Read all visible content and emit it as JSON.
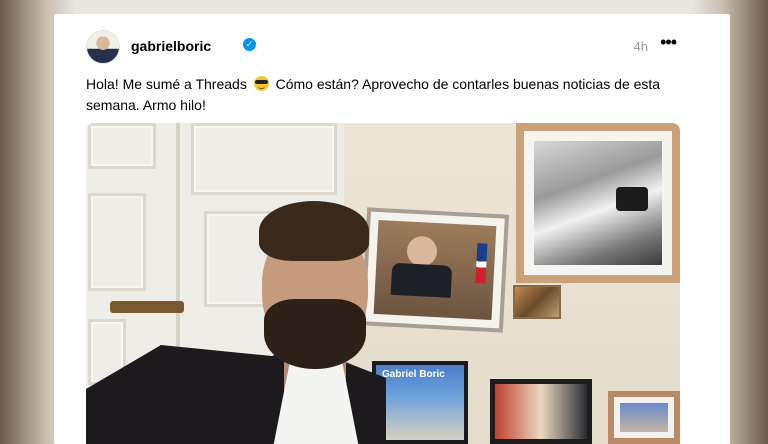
{
  "post": {
    "username": "gabrielboric",
    "verified_icon": "verified-badge-icon",
    "timestamp": "4h",
    "more_label": "•••",
    "text_before_emoji": "Hola! Me sumé a Threads",
    "emoji": "sunglasses-emoji",
    "text_after_emoji": "Cómo están? Aprovecho de contarles buenas noticias de esta semana. Armo hilo!",
    "photo_poster_text": "Gabriel Boric"
  },
  "colors": {
    "verified": "#0095f6",
    "timestamp": "#999999"
  }
}
